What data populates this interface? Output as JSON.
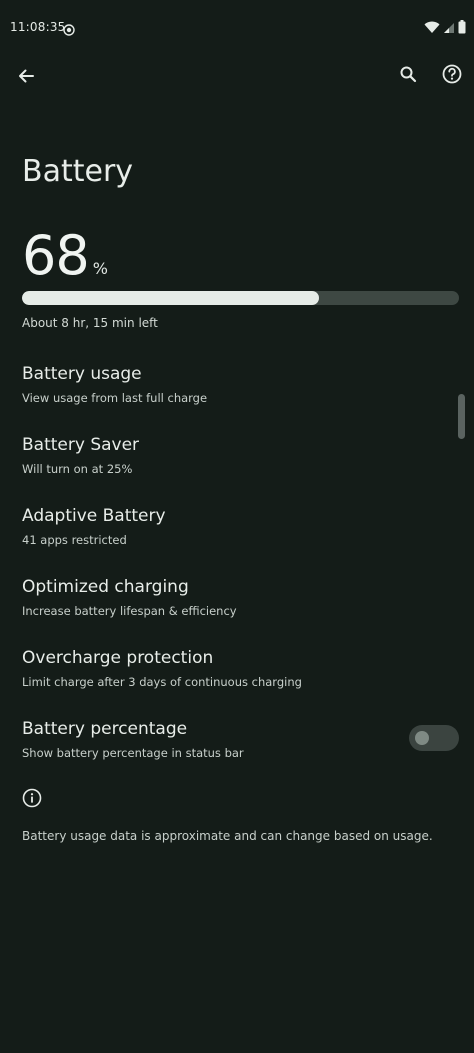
{
  "status_bar": {
    "time": "11:08:35",
    "icons": [
      "record-icon",
      "wifi-icon",
      "signal-icon",
      "battery-icon"
    ]
  },
  "app_bar": {
    "icons": [
      "back-arrow-icon",
      "search-icon",
      "help-icon"
    ]
  },
  "page": {
    "title": "Battery",
    "battery_percent": "68",
    "percent_sign": "%",
    "level_fraction": 0.68,
    "time_left": "About 8 hr, 15 min left"
  },
  "settings": [
    {
      "title": "Battery usage",
      "summary": "View usage from last full charge"
    },
    {
      "title": "Battery Saver",
      "summary": "Will turn on at 25%"
    },
    {
      "title": "Adaptive Battery",
      "summary": "41 apps restricted"
    },
    {
      "title": "Optimized charging",
      "summary": "Increase battery lifespan & efficiency"
    },
    {
      "title": "Overcharge protection",
      "summary": "Limit charge after 3 days of continuous charging"
    },
    {
      "title": "Battery percentage",
      "summary": "Show battery percentage in status bar",
      "toggle_on": false
    }
  ],
  "footer": {
    "icon": "info-icon",
    "text": "Battery usage data is approximate and can change based on usage."
  },
  "colors": {
    "background": "#141c18",
    "bar_fill": "#e6ece7",
    "bar_track": "#3e4843"
  }
}
